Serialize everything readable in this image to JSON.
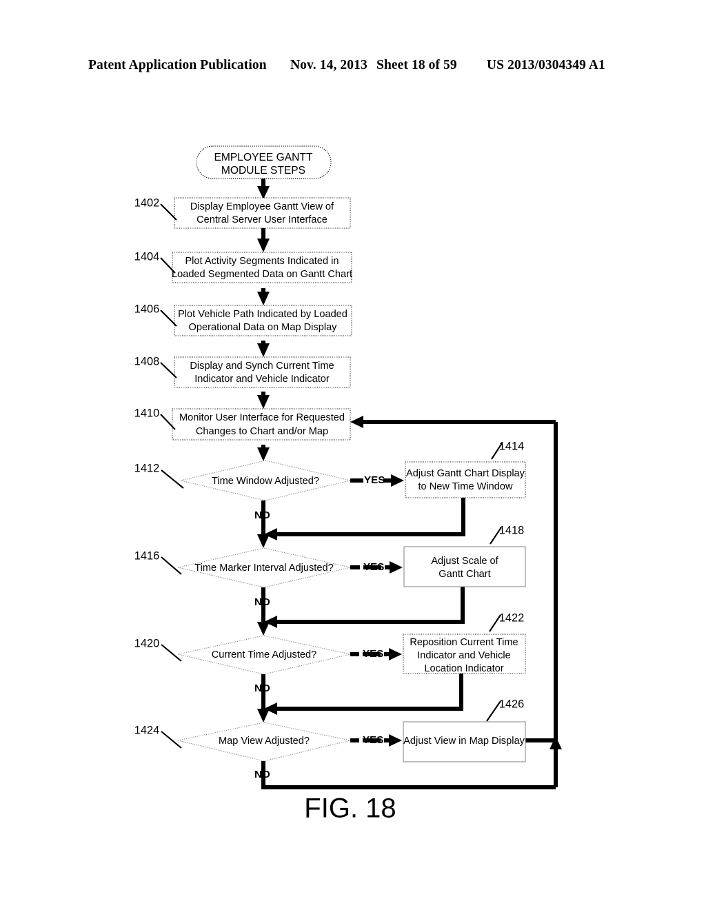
{
  "header": {
    "publication": "Patent Application Publication",
    "date": "Nov. 14, 2013",
    "sheet": "Sheet 18 of 59",
    "number": "US 2013/0304349 A1"
  },
  "figure": {
    "caption": "FIG. 18",
    "terminator": {
      "line1": "EMPLOYEE GANTT",
      "line2": "MODULE STEPS"
    },
    "steps": [
      {
        "ref": "1402",
        "line1": "Display Employee Gantt View of",
        "line2": "Central Server User Interface"
      },
      {
        "ref": "1404",
        "line1": "Plot Activity Segments Indicated in",
        "line2": "Loaded Segmented Data on Gantt Chart"
      },
      {
        "ref": "1406",
        "line1": "Plot Vehicle Path Indicated by Loaded",
        "line2": "Operational Data on Map Display"
      },
      {
        "ref": "1408",
        "line1": "Display and Synch Current Time",
        "line2": "Indicator and Vehicle Indicator"
      },
      {
        "ref": "1410",
        "line1": "Monitor User Interface for Requested",
        "line2": "Changes to Chart and/or Map"
      }
    ],
    "decisions": [
      {
        "ref": "1412",
        "question": "Time Window Adjusted?",
        "yes_label": "YES",
        "no_label": "NO",
        "action": {
          "ref": "1414",
          "line1": "Adjust Gantt Chart Display",
          "line2": "to New Time Window",
          "line3": ""
        }
      },
      {
        "ref": "1416",
        "question": "Time Marker Interval Adjusted?",
        "yes_label": "YES",
        "no_label": "NO",
        "action": {
          "ref": "1418",
          "line1": "Adjust Scale of",
          "line2": "Gantt Chart",
          "line3": ""
        }
      },
      {
        "ref": "1420",
        "question": "Current Time Adjusted?",
        "yes_label": "YES",
        "no_label": "NO",
        "action": {
          "ref": "1422",
          "line1": "Reposition Current Time",
          "line2": "Indicator and Vehicle",
          "line3": "Location Indicator"
        }
      },
      {
        "ref": "1424",
        "question": "Map View Adjusted?",
        "yes_label": "YES",
        "no_label": "NO",
        "action": {
          "ref": "1426",
          "line1": "Adjust View in Map Display",
          "line2": "",
          "line3": ""
        }
      }
    ]
  },
  "colors": {
    "ink": "#000000",
    "paper": "#ffffff",
    "box_stroke": "#000000",
    "diamond_stroke": "#6f6f6f"
  }
}
